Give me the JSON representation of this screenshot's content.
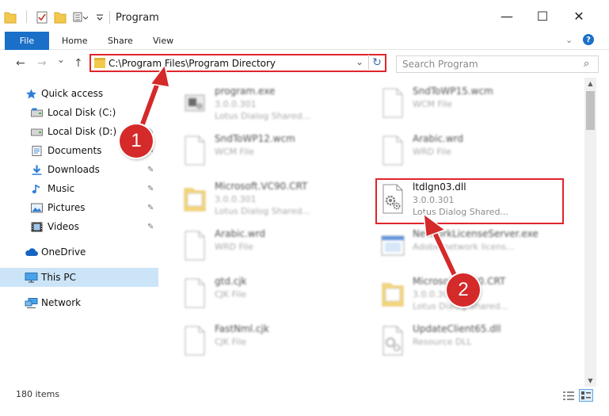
{
  "window": {
    "title": "Program",
    "minimize_glyph": "—",
    "maximize_glyph": "☐",
    "close_glyph": "✕"
  },
  "ribbon": {
    "file": "File",
    "home": "Home",
    "share": "Share",
    "view": "View",
    "help_glyph": "?"
  },
  "nav_buttons": {
    "back": "←",
    "forward": "→",
    "recent": "⌄",
    "up": "↑"
  },
  "address": {
    "path": "C:\\Program Files\\Program Directory",
    "dropdown_glyph": "⌄",
    "refresh_glyph": "↻"
  },
  "search": {
    "placeholder": "Search Program",
    "icon_glyph": "⌕"
  },
  "sidebar": {
    "items": [
      {
        "label": "Quick access",
        "icon": "star-icon"
      },
      {
        "label": "Local Disk (C:)",
        "icon": "drive-icon"
      },
      {
        "label": "Local Disk (D:)",
        "icon": "drive-icon"
      },
      {
        "label": "Documents",
        "icon": "documents-icon"
      },
      {
        "label": "Downloads",
        "icon": "downloads-icon"
      },
      {
        "label": "Music",
        "icon": "music-icon"
      },
      {
        "label": "Pictures",
        "icon": "pictures-icon"
      },
      {
        "label": "Videos",
        "icon": "videos-icon"
      },
      {
        "label": "OneDrive",
        "icon": "cloud-icon"
      },
      {
        "label": "This PC",
        "icon": "computer-icon"
      },
      {
        "label": "Network",
        "icon": "network-icon"
      }
    ],
    "pin_glyph": "📌"
  },
  "files": [
    {
      "name": "program.exe",
      "line1": "3.0.0.301",
      "line2": "Lotus Dialog Shared...",
      "icon": "exe-icon"
    },
    {
      "name": "SndToWP15.wcm",
      "line1": "WCM File",
      "line2": "",
      "icon": "document-icon"
    },
    {
      "name": "SndToWP12.wcm",
      "line1": "WCM File",
      "line2": "",
      "icon": "document-icon"
    },
    {
      "name": "Arabic.wrd",
      "line1": "WRD File",
      "line2": "",
      "icon": "document-icon"
    },
    {
      "name": "Microsoft.VC90.CRT",
      "line1": "3.0.0.301",
      "line2": "Lotus Dialog Shared...",
      "icon": "folder-icon"
    },
    {
      "name": "ltdlgn03.dll",
      "line1": "3.0.0.301",
      "line2": "Lotus Dialog Shared...",
      "icon": "dll-gear-icon"
    },
    {
      "name": "Arabic.wrd",
      "line1": "WRD File",
      "line2": "",
      "icon": "document-icon"
    },
    {
      "name": "NetworkLicenseServer.exe",
      "line1": "Adobe network licens...",
      "line2": "",
      "icon": "app-window-icon"
    },
    {
      "name": "gtd.cjk",
      "line1": "CJK File",
      "line2": "",
      "icon": "document-icon"
    },
    {
      "name": "Microsoft.VC90.CRT",
      "line1": "3.0.0.301",
      "line2": "Lotus Dialog Shared...",
      "icon": "folder-icon"
    },
    {
      "name": "FastNml.cjk",
      "line1": "CJK File",
      "line2": "",
      "icon": "document-icon"
    },
    {
      "name": "UpdateClient65.dll",
      "line1": "Resource DLL",
      "line2": "",
      "icon": "dll-gear-icon"
    }
  ],
  "status": {
    "count": "180 items"
  },
  "annotations": {
    "marker_1": "1",
    "marker_2": "2"
  },
  "colors": {
    "accent": "#1a6fc9",
    "highlight": "#e0252b",
    "marker": "#d42a2a",
    "selected_nav": "#cce4f7"
  }
}
